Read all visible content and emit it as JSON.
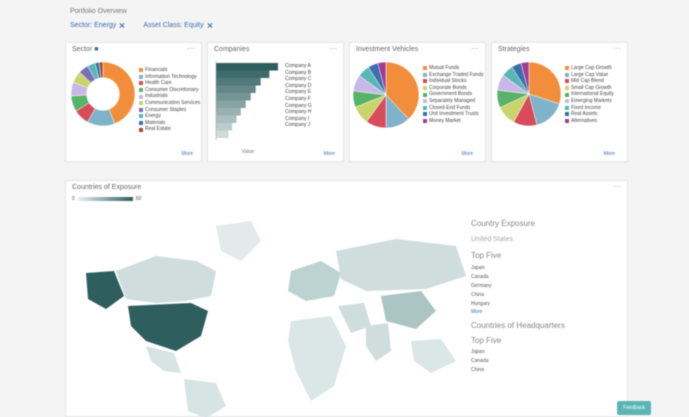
{
  "breadcrumb": "Portfolio Overview",
  "filters": [
    {
      "label": "Sector: Energy",
      "removable": true
    },
    {
      "label": "Asset Class: Equity",
      "removable": true
    }
  ],
  "panels": {
    "sector": {
      "title": "Sector",
      "more": "More",
      "chart_data": {
        "type": "pie",
        "donut": true,
        "slices": [
          {
            "label": "Financials",
            "value": 44,
            "color": "#f28e3b"
          },
          {
            "label": "Information Technology",
            "value": 14,
            "color": "#7fb3c9"
          },
          {
            "label": "Health Care",
            "value": 8,
            "color": "#d84b5a"
          },
          {
            "label": "Consumer Discretionary",
            "value": 8,
            "color": "#58b368"
          },
          {
            "label": "Industrials",
            "value": 7,
            "color": "#c7b8e8"
          },
          {
            "label": "Communication Services",
            "value": 6,
            "color": "#c9d46a"
          },
          {
            "label": "Consumer Staples",
            "value": 5,
            "color": "#7b6bb8"
          },
          {
            "label": "Energy",
            "value": 4,
            "color": "#5ab5b5"
          },
          {
            "label": "Materials",
            "value": 2,
            "color": "#3a6fb0"
          },
          {
            "label": "Real Estate",
            "value": 2,
            "color": "#a0522d"
          }
        ]
      }
    },
    "companies": {
      "title": "Companies",
      "more": "More",
      "chart_data": {
        "type": "bar",
        "orientation": "horizontal",
        "categories": [
          "Company A",
          "Company B",
          "Company C",
          "Company D",
          "Company E",
          "Company F",
          "Company G",
          "Company H",
          "Company I",
          "Company J"
        ],
        "values": [
          100,
          86,
          72,
          64,
          56,
          48,
          40,
          33,
          26,
          20
        ],
        "color": "#2e5e5e",
        "xlabel": "Value"
      }
    },
    "investment_vehicles": {
      "title": "Investment Vehicles",
      "more": "More",
      "chart_data": {
        "type": "pie",
        "slices": [
          {
            "label": "Mutual Funds",
            "value": 38,
            "color": "#f28e3b"
          },
          {
            "label": "Exchange Traded Funds",
            "value": 12,
            "color": "#7fb3c9"
          },
          {
            "label": "Individual Stocks",
            "value": 10,
            "color": "#d84b5a"
          },
          {
            "label": "Corporate Bonds",
            "value": 9,
            "color": "#c9d46a"
          },
          {
            "label": "Government Bonds",
            "value": 8,
            "color": "#58b368"
          },
          {
            "label": "Separately Managed",
            "value": 8,
            "color": "#c7b8e8"
          },
          {
            "label": "Closed-End Funds",
            "value": 6,
            "color": "#5ab5b5"
          },
          {
            "label": "Unit Investment Trusts",
            "value": 5,
            "color": "#3a6fb0"
          },
          {
            "label": "Money Market",
            "value": 4,
            "color": "#a33c8f"
          }
        ]
      }
    },
    "strategies": {
      "title": "Strategies",
      "more": "More",
      "chart_data": {
        "type": "pie",
        "slices": [
          {
            "label": "Large Cap Growth",
            "value": 30,
            "color": "#f28e3b"
          },
          {
            "label": "Large Cap Value",
            "value": 16,
            "color": "#7fb3c9"
          },
          {
            "label": "Mid Cap Blend",
            "value": 12,
            "color": "#d84b5a"
          },
          {
            "label": "Small Cap Growth",
            "value": 10,
            "color": "#c9d46a"
          },
          {
            "label": "International Equity",
            "value": 9,
            "color": "#58b368"
          },
          {
            "label": "Emerging Markets",
            "value": 8,
            "color": "#c7b8e8"
          },
          {
            "label": "Fixed Income",
            "value": 6,
            "color": "#5ab5b5"
          },
          {
            "label": "Real Assets",
            "value": 5,
            "color": "#3a6fb0"
          },
          {
            "label": "Alternatives",
            "value": 4,
            "color": "#a33c8f"
          }
        ]
      }
    },
    "map": {
      "title": "Countries of Exposure",
      "scale_min": "0",
      "scale_max": "60",
      "side": {
        "heading": "Country Exposure",
        "selected": "United States",
        "top_label": "Top Five",
        "items": [
          "Japan",
          "Canada",
          "Germany",
          "China",
          "Hungary"
        ],
        "more": "More",
        "heading2": "Countries of Headquarters",
        "top_label2": "Top Five",
        "items2": [
          "Japan",
          "Canada",
          "China"
        ]
      }
    }
  },
  "fab_label": "Feedback"
}
